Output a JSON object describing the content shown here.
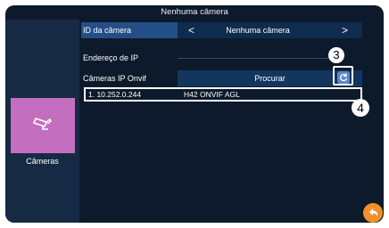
{
  "header": {
    "title": "Nenhuma câmera"
  },
  "sidebar": {
    "tile_label": "Câmeras",
    "tile_color": "#c46ec0",
    "tile_icon": "camera-icon"
  },
  "form": {
    "camera_id_label": "ID da câmera",
    "camera_id_value": "Nenhuma câmera",
    "ip_address_label": "Endereço de IP",
    "onvif_label": "Câmeras IP Onvif",
    "search_button": "Procurar"
  },
  "results": [
    {
      "index_ip": "1. 10.252.0.244",
      "model": "H42 ONVIF AGL"
    }
  ],
  "callouts": {
    "refresh": "3",
    "result": "4"
  },
  "icons": {
    "refresh": "refresh-icon",
    "back": "back-arrow-icon"
  },
  "colors": {
    "accent": "#f0922a",
    "selected_row": "#1d4f8a"
  }
}
